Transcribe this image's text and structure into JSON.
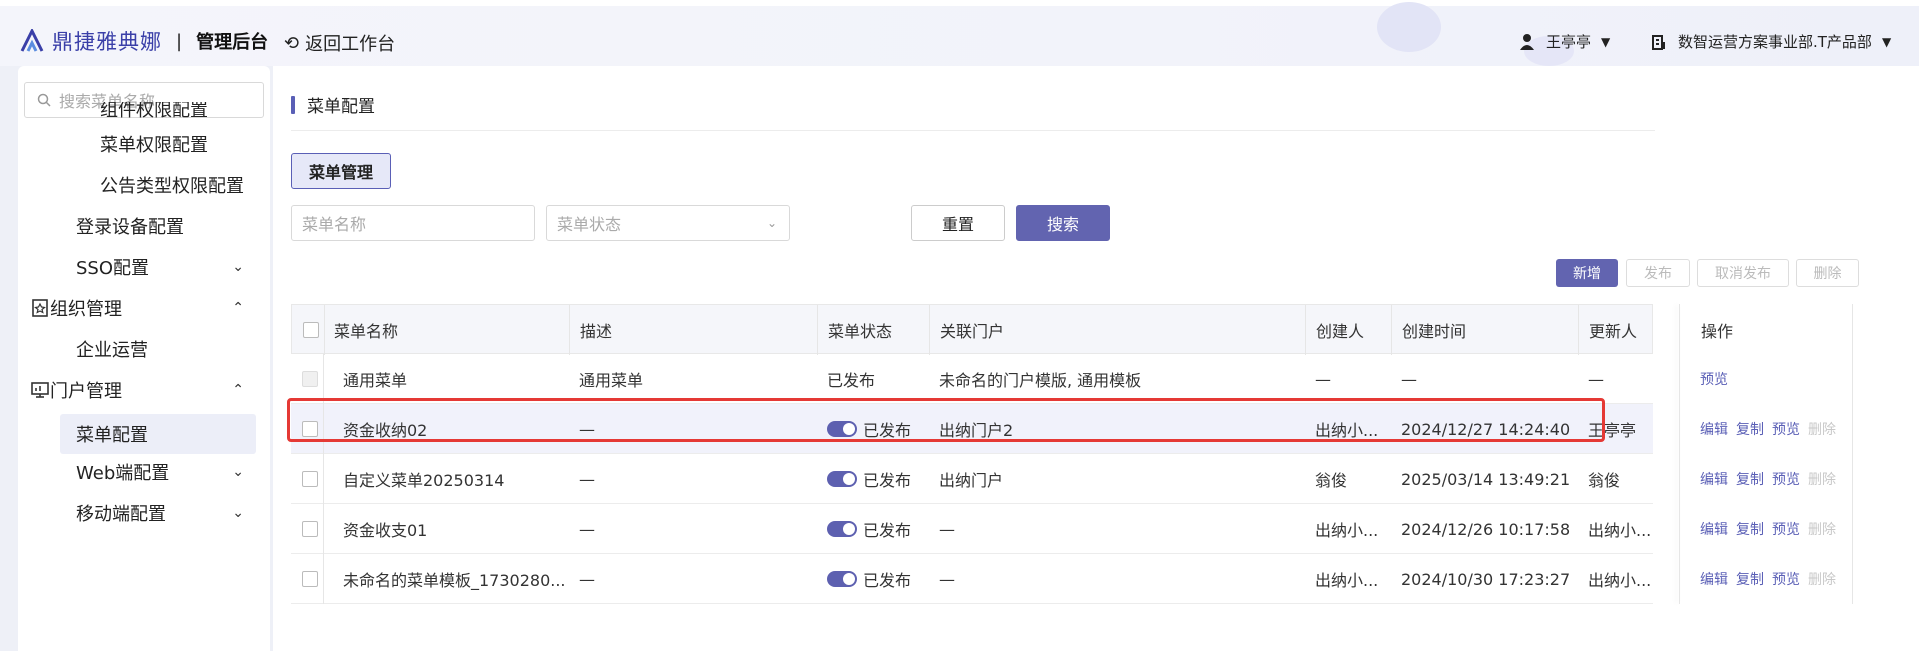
{
  "header": {
    "brand": "鼎捷雅典娜",
    "separator": "|",
    "admin_title": "管理后台",
    "back_label": "返回工作台",
    "user_name": "王亭亭",
    "org_name": "数智运营方案事业部.T产品部"
  },
  "sidebar": {
    "search_placeholder": "搜索菜单名称",
    "items": [
      {
        "label": "组件权限配置"
      },
      {
        "label": "菜单权限配置"
      },
      {
        "label": "公告类型权限配置"
      },
      {
        "label": "登录设备配置"
      },
      {
        "label": "SSO配置"
      },
      {
        "label": "组织管理"
      },
      {
        "label": "企业运营"
      },
      {
        "label": "门户管理"
      },
      {
        "label": "菜单配置"
      },
      {
        "label": "Web端配置"
      },
      {
        "label": "移动端配置"
      }
    ]
  },
  "main": {
    "page_title": "菜单配置",
    "tab_label": "菜单管理",
    "filters": {
      "name_placeholder": "菜单名称",
      "status_placeholder": "菜单状态",
      "reset_label": "重置",
      "search_label": "搜索"
    },
    "actions": {
      "new_label": "新增",
      "publish_label": "发布",
      "unpublish_label": "取消发布",
      "delete_label": "删除"
    },
    "table": {
      "columns": [
        "菜单名称",
        "描述",
        "菜单状态",
        "关联门户",
        "创建人",
        "创建时间",
        "更新人",
        "操作"
      ],
      "rows": [
        {
          "name": "通用菜单",
          "desc": "通用菜单",
          "status": "已发布",
          "portal": "未命名的门户模版, 通用模板",
          "creator": "—",
          "created": "—",
          "updater": "—",
          "ops": [
            "预览"
          ]
        },
        {
          "name": "资金收纳02",
          "desc": "—",
          "status": "已发布",
          "portal": "出纳门户2",
          "creator": "出纳小...",
          "created": "2024/12/27 14:24:40",
          "updater": "王亭亭",
          "ops": [
            "编辑",
            "复制",
            "预览",
            "删除"
          ]
        },
        {
          "name": "自定义菜单20250314",
          "desc": "—",
          "status": "已发布",
          "portal": "出纳门户",
          "creator": "翁俊",
          "created": "2025/03/14 13:49:21",
          "updater": "翁俊",
          "ops": [
            "编辑",
            "复制",
            "预览",
            "删除"
          ]
        },
        {
          "name": "资金收支01",
          "desc": "—",
          "status": "已发布",
          "portal": "—",
          "creator": "出纳小...",
          "created": "2024/12/26 10:17:58",
          "updater": "出纳小...",
          "ops": [
            "编辑",
            "复制",
            "预览",
            "删除"
          ]
        },
        {
          "name": "未命名的菜单模板_1730280...",
          "desc": "—",
          "status": "已发布",
          "portal": "—",
          "creator": "出纳小...",
          "created": "2024/10/30 17:23:27",
          "updater": "出纳小...",
          "ops": [
            "编辑",
            "复制",
            "预览",
            "删除"
          ]
        }
      ]
    }
  },
  "colors": {
    "accent": "#6264b0",
    "highlight": "#e53935",
    "brand": "#3a3fa8"
  }
}
